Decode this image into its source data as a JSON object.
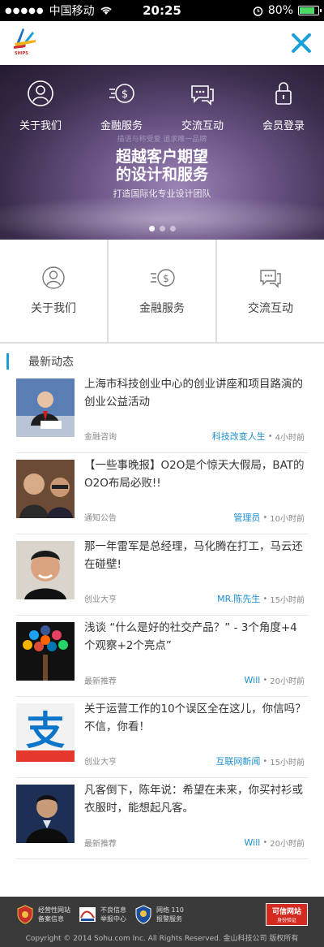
{
  "status_bar": {
    "carrier": "中国移动",
    "time": "20:25",
    "battery": "80%",
    "battery_level": 0.8
  },
  "header": {
    "logo_text": "SHIPS"
  },
  "banner": {
    "nav": [
      {
        "label": "关于我们",
        "icon": "user-icon"
      },
      {
        "label": "金融服务",
        "icon": "coin-icon"
      },
      {
        "label": "交流互动",
        "icon": "chat-icon"
      },
      {
        "label": "会员登录",
        "icon": "lock-icon"
      }
    ],
    "faint_text": "描语与称受爱 追求唯一品牌",
    "title_line1": "超越客户期望",
    "title_line2": "的设计和服务",
    "subtitle": "打造国际化专业设计团队",
    "slide_count": 3,
    "active_slide": 0
  },
  "quick_links": [
    {
      "label": "关于我们",
      "icon": "user-icon"
    },
    {
      "label": "金融服务",
      "icon": "coin-icon"
    },
    {
      "label": "交流互动",
      "icon": "chat-icon"
    }
  ],
  "news": {
    "heading": "最新动态",
    "items": [
      {
        "title": "上海市科技创业中心的创业讲座和项目路演的创业公益活动",
        "category": "金融咨询",
        "author": "科技改变人生",
        "dot": "•",
        "time": "4小时前",
        "thumb": "speaker-photo"
      },
      {
        "title": "【一些事晚报】O2O是个惊天大假局，BAT的O2O布局必败!!",
        "category": "通知公告",
        "author": "管理员",
        "dot": "•",
        "time": "10小时前",
        "thumb": "two-men-photo"
      },
      {
        "title": "那一年雷军是总经理，马化腾在打工，马云还在碰壁!",
        "category": "创业大亨",
        "author": "MR.陈先生",
        "dot": "•",
        "time": "15小时前",
        "thumb": "smiling-man-photo"
      },
      {
        "title": "浅谈 “什么是好的社交产品？” - 3个角度+4个观察+2个亮点”",
        "category": "最新推荐",
        "author": "Will",
        "dot": "•",
        "time": "20小时前",
        "thumb": "social-icons-tree"
      },
      {
        "title": "关于运营工作的10个误区全在这儿，你信吗？不信，你看！",
        "category": "创业大亨",
        "author": "互联网新闻",
        "dot": "•",
        "time": "15小时前",
        "thumb": "alipay-logo"
      },
      {
        "title": "凡客倒下，陈年说：希望在未来，你买衬衫或衣服时，能想起凡客。",
        "category": "最新推荐",
        "author": "Will",
        "dot": "•",
        "time": "20小时前",
        "thumb": "man-portrait"
      }
    ]
  },
  "footer": {
    "badges": [
      {
        "line1": "经营性网站",
        "line2": "备案信息",
        "icon": "shield-icon"
      },
      {
        "line1": "不良信息",
        "line2": "举报中心",
        "icon": "report-icon"
      },
      {
        "line1": "网络 110",
        "line2": "报警服务",
        "icon": "police-icon"
      }
    ],
    "credit_line1": "可信网站",
    "credit_line2": "身份验证",
    "copyright": "Copyright © 2014 Sohu.com Inc. All Rights Reserved. 金山科技公司 版权所有"
  }
}
